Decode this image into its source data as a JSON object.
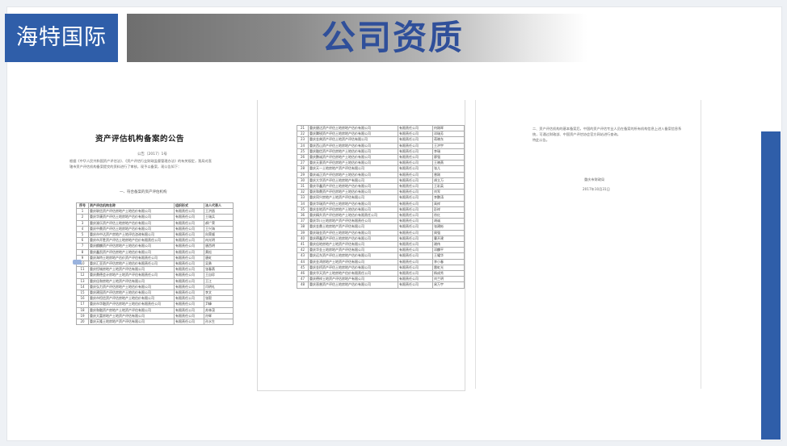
{
  "header": {
    "company": "海特国际",
    "title": "公司资质"
  },
  "doc1": {
    "title": "资产评估机构备案的公告",
    "number": "公告〔2017〕1号",
    "paragraph": "根据《中华人民共和国资产评估法》、《资产评估行业财政监督管理办法》的有关规定，我局对直辖市资产评估机构备案提交的资料进行了审核，现予以备案，现公告如下：",
    "subtitle": "一、符合备案的资产评估机构",
    "headers": [
      "序号",
      "资产评估机构名称",
      "组织形式",
      "法人代表人"
    ],
    "rows": [
      [
        "1",
        "重庆联信资产评估房地产土地估价有限公司",
        "有限责任公司",
        "王洪昌"
      ],
      [
        "2",
        "重庆华康资产评估土地房地产估价有限公司",
        "有限责任公司",
        "王瑞兵"
      ],
      [
        "3",
        "重庆渝乐资产评估土地房地产估价有限公司",
        "有限责任公司",
        "郝广荣"
      ],
      [
        "4",
        "重庆中鼎资产评估土地房地产估价有限公司",
        "有限责任公司",
        "王兴海"
      ],
      [
        "5",
        "重庆市中达资产房地产土地评估咨询有限公司",
        "有限责任公司",
        "向荣顺"
      ],
      [
        "6",
        "重庆市开胜资产评估土地房地产估价有限责任公司",
        "有限责任公司",
        "冉光明"
      ],
      [
        "7",
        "重庆麒麟资产评估房地产土地估价有限公司",
        "有限责任公司",
        "唐西明"
      ],
      [
        "8",
        "重庆鑫凯资产评估房地产土地估价有限公司",
        "有限责任公司",
        "黄松"
      ],
      [
        "9",
        "重庆海特土地房地产估价资产评估有限责任公司",
        "有限责任公司",
        "唐虹"
      ],
      [
        "10",
        "重庆汇亚资产评估房地产土地估价有限责任公司",
        "有限责任公司",
        "吴勇"
      ],
      [
        "11",
        "重庆恒城房地产土地资产评估有限公司",
        "有限责任公司",
        "张春燕"
      ],
      [
        "12",
        "重庆鼎德会计房地产土地资产评估有限责任公司",
        "有限责任公司",
        "王自珍"
      ],
      [
        "13",
        "重庆佳和房地产土地资产评估有限公司",
        "有限责任公司",
        "王江"
      ],
      [
        "14",
        "重庆弘力资产评估房地产土地估价有限公司",
        "有限责任公司",
        "闫明礼"
      ],
      [
        "15",
        "重庆建园资产评估房地产土地估价有限公司",
        "有限责任公司",
        "李文"
      ],
      [
        "16",
        "重庆市恒信资产评估房地产土地估价有限公司",
        "有限责任公司",
        "张毅"
      ],
      [
        "17",
        "重庆市华融资产评估房地产土地估价有限责任公司",
        "有限责任公司",
        "尹峰"
      ],
      [
        "18",
        "重庆和融资产房地产土地资产评估有限公司",
        "有限责任公司",
        "苏林茂"
      ],
      [
        "19",
        "重庆大富房地产土地资产评估有限公司",
        "有限责任公司",
        "孙辉"
      ],
      [
        "20",
        "重庆天隆土地房地产资产评估有限公司",
        "有限责任公司",
        "孙水生"
      ]
    ]
  },
  "doc2": {
    "rows": [
      [
        "21",
        "重庆捷达资产评估土地房地产估价有限公司",
        "有限责任公司",
        "何刚晖"
      ],
      [
        "22",
        "重庆腾锐资产评估土地房地产估价有限公司",
        "有限责任公司",
        "邓瑞芳"
      ],
      [
        "23",
        "重庆金典资产评估土地资产评估有限公司",
        "有限责任公司",
        "蒋晓东"
      ],
      [
        "24",
        "重庆西山资产评估土地房地产估价有限公司",
        "有限责任公司",
        "王洪宇"
      ],
      [
        "25",
        "重庆融信资产评估房地产土地估价有限公司",
        "有限责任公司",
        "李瑞"
      ],
      [
        "26",
        "重庆鹏诚资产评估房地产土地估价有限公司",
        "有限责任公司",
        "廖强"
      ],
      [
        "27",
        "重庆天意资产评估房地产土地估价有限公司",
        "有限责任公司",
        "王晓燕"
      ],
      [
        "28",
        "重庆天一土地房地产资产评估有限公司",
        "有限责任公司",
        "张儿"
      ],
      [
        "29",
        "重庆诚正资产评估房地产土地估价有限公司",
        "有限责任公司",
        "曾刚"
      ],
      [
        "30",
        "重庆大华资产评估土地房地产有限公司",
        "有限责任公司",
        "胡立万"
      ],
      [
        "31",
        "重庆华鑫资产评估土地房地产估价有限公司",
        "有限责任公司",
        "王彩英"
      ],
      [
        "32",
        "重庆和鼎资产评估房地产土地估价有限公司",
        "有限责任公司",
        "刘军"
      ],
      [
        "33",
        "重庆同兴房地产土地资产评估有限公司",
        "有限责任公司",
        "李鹏涛"
      ],
      [
        "34",
        "重庆华瑞资产评估土地房地产估价有限公司",
        "有限责任公司",
        "高祥"
      ],
      [
        "35",
        "重庆金地资产评估房地产土地估价有限公司",
        "有限责任公司",
        "彭祥"
      ],
      [
        "36",
        "重庆精升资产评估房地产土地估价有限责任公司",
        "有限责任公司",
        "徐红"
      ],
      [
        "37",
        "重庆华川土地房地产资产评估有限责任公司",
        "有限责任公司",
        "胡诚"
      ],
      [
        "38",
        "重庆金鼎土地房地产资产评估有限公司",
        "有限责任公司",
        "张建彬"
      ],
      [
        "39",
        "重庆瑞金资产评估土地房地产估价有限公司",
        "有限责任公司",
        "周强"
      ],
      [
        "40",
        "重庆德鑫资产评估土地房地产估价有限公司",
        "有限责任公司",
        "曹开建"
      ],
      [
        "41",
        "重庆佳地房地产土地资产评估有限公司",
        "有限责任公司",
        "谢伟"
      ],
      [
        "42",
        "重庆华金土地房地产资产评估有限公司",
        "有限责任公司",
        "邓麟平"
      ],
      [
        "43",
        "重庆远东资产评估土地房地产估价有限公司",
        "有限责任公司",
        "王耀华"
      ],
      [
        "44",
        "重庆金鸿房地产土地资产评估有限公司",
        "有限责任公司",
        "李小春"
      ],
      [
        "45",
        "重庆金桥资产评估土地房地产估价有限公司",
        "有限责任公司",
        "雷虹光"
      ],
      [
        "46",
        "重庆华天资产土地房地产估价有限责任公司",
        "有限责任公司",
        "杨成秀"
      ],
      [
        "47",
        "重庆德祥土地资产评估房地产有限公司",
        "有限责任公司",
        "刘兰明"
      ],
      [
        "48",
        "重庆晋普资产评估土地房地产估价有限公司",
        "有限责任公司",
        "易万宇"
      ]
    ]
  },
  "doc3": {
    "paragraph": "二、资产评估机构的基本备案后，中国的资产评估专业人员在备案的所有机构信息上进入备案信息系统，可通过财政部、中国资产评估协会官方网站进行查询。",
    "note": "特此公告。",
    "org": "重庆市财政局",
    "date": "2017年10月31日"
  }
}
